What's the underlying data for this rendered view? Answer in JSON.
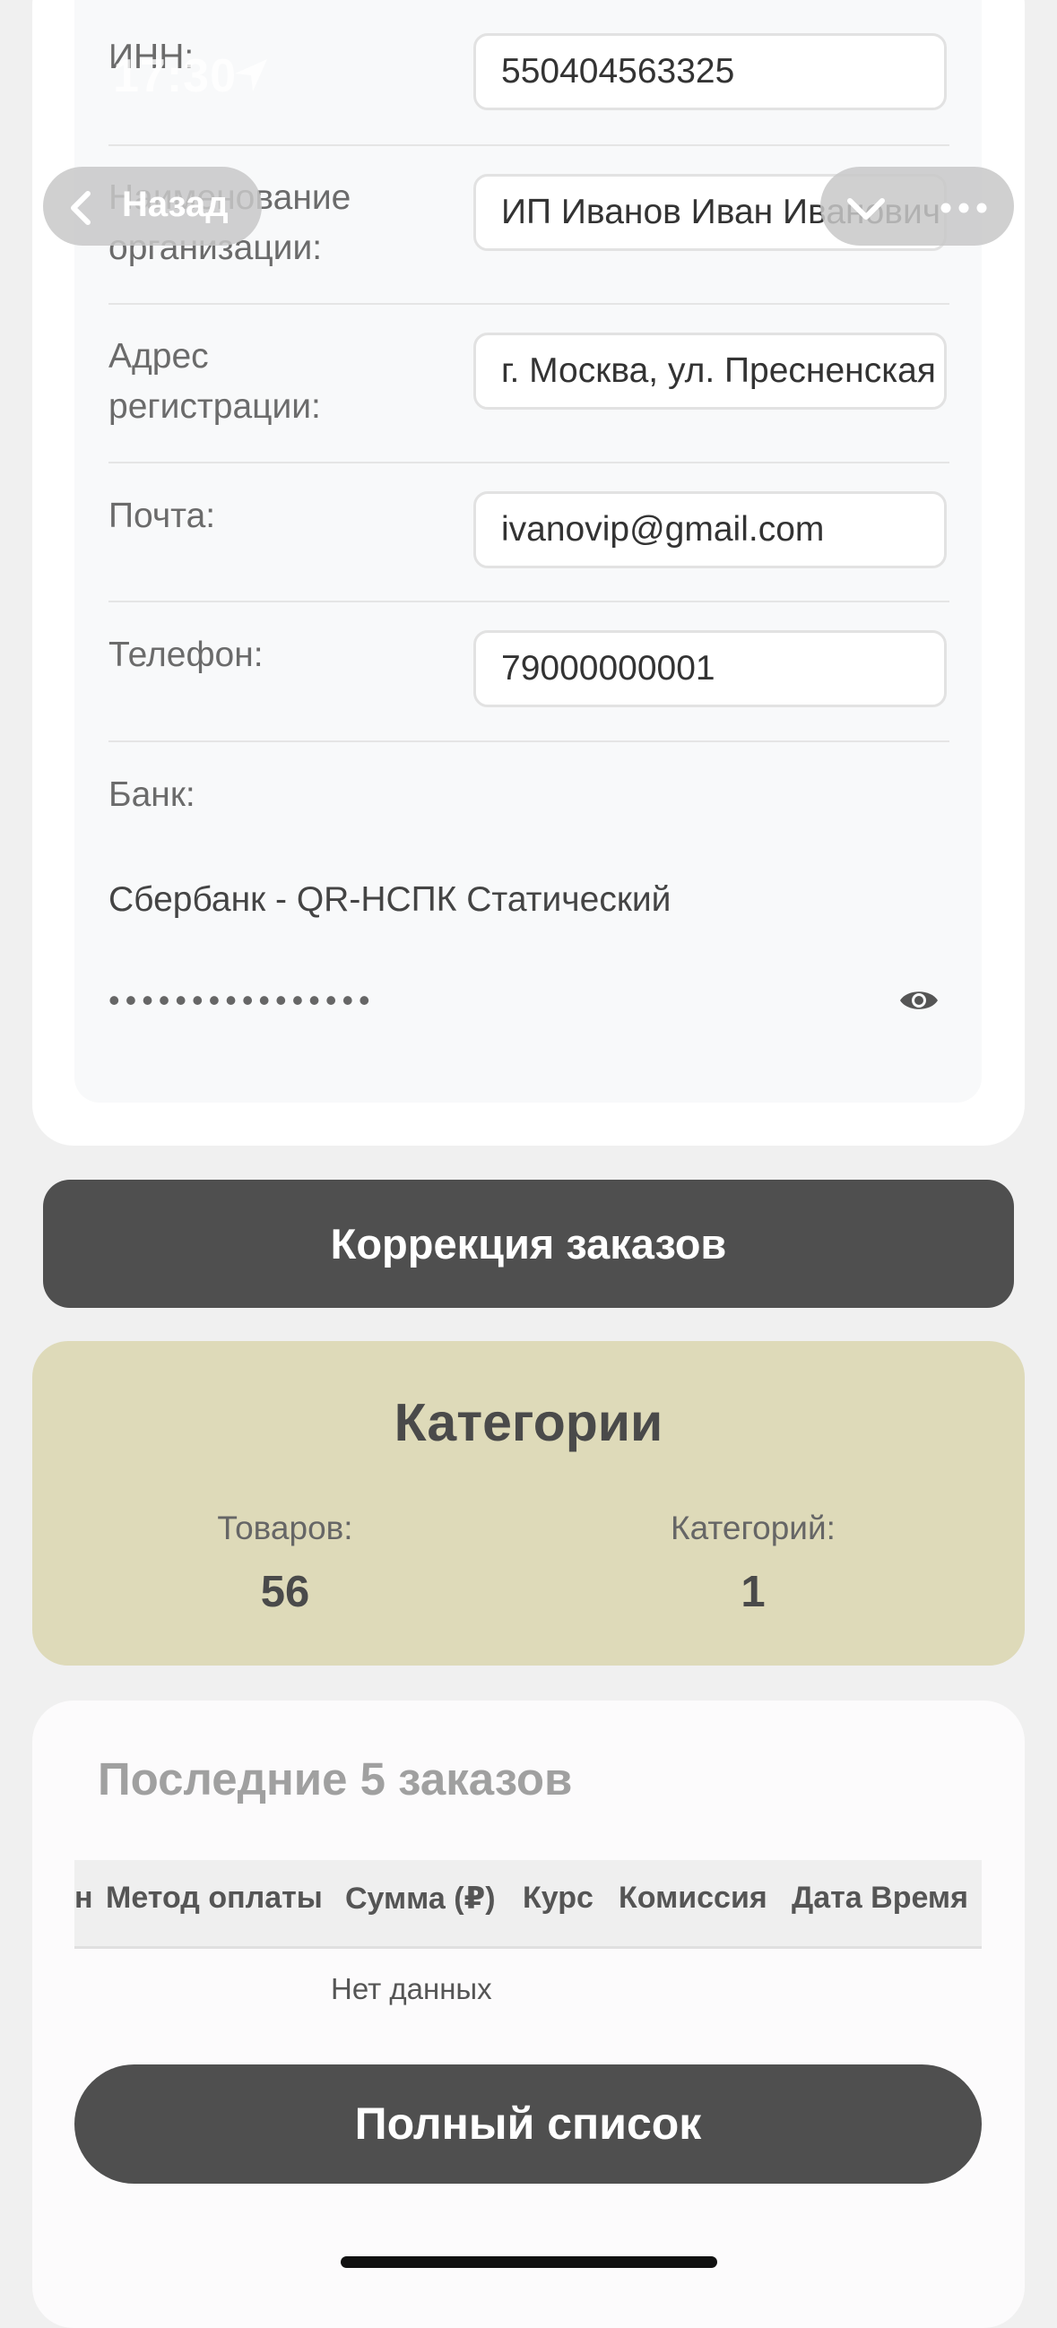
{
  "status_bar": {
    "time": "17:30"
  },
  "nav": {
    "back_label": "Назад"
  },
  "profile": {
    "inn_label": "ИНН:",
    "inn_value": "550404563325",
    "org_label_1": "Наименование",
    "org_label_2": "организации:",
    "org_value": "ИП Иванов Иван Иванович",
    "addr_label_1": "Адрес",
    "addr_label_2": "регистрации:",
    "addr_value": "г. Москва, ул. Пресненская",
    "email_label": "Почта:",
    "email_value": "ivanovip@gmail.com",
    "phone_label": "Телефон:",
    "phone_value": "79000000001",
    "bank_label": "Банк:",
    "bank_value": "Сбербанк - QR-НСПК Статический",
    "secret_mask": "••••••••••••••••"
  },
  "correction_button": "Коррекция заказов",
  "categories": {
    "title": "Категории",
    "goods_label": "Товаров:",
    "goods_value": "56",
    "cats_label": "Категорий:",
    "cats_value": "1"
  },
  "orders": {
    "title": "Последние 5 заказов",
    "columns": [
      "н",
      "Метод оплаты",
      "Сумма (₽)",
      "Курс",
      "Комиссия",
      "Дата Время"
    ],
    "empty_text": "Нет данных",
    "full_list_button": "Полный список"
  },
  "colors": {
    "dark_button": "#4f4f4f",
    "categories_bg": "#dedab9",
    "page_bg": "#f0f0f0"
  }
}
